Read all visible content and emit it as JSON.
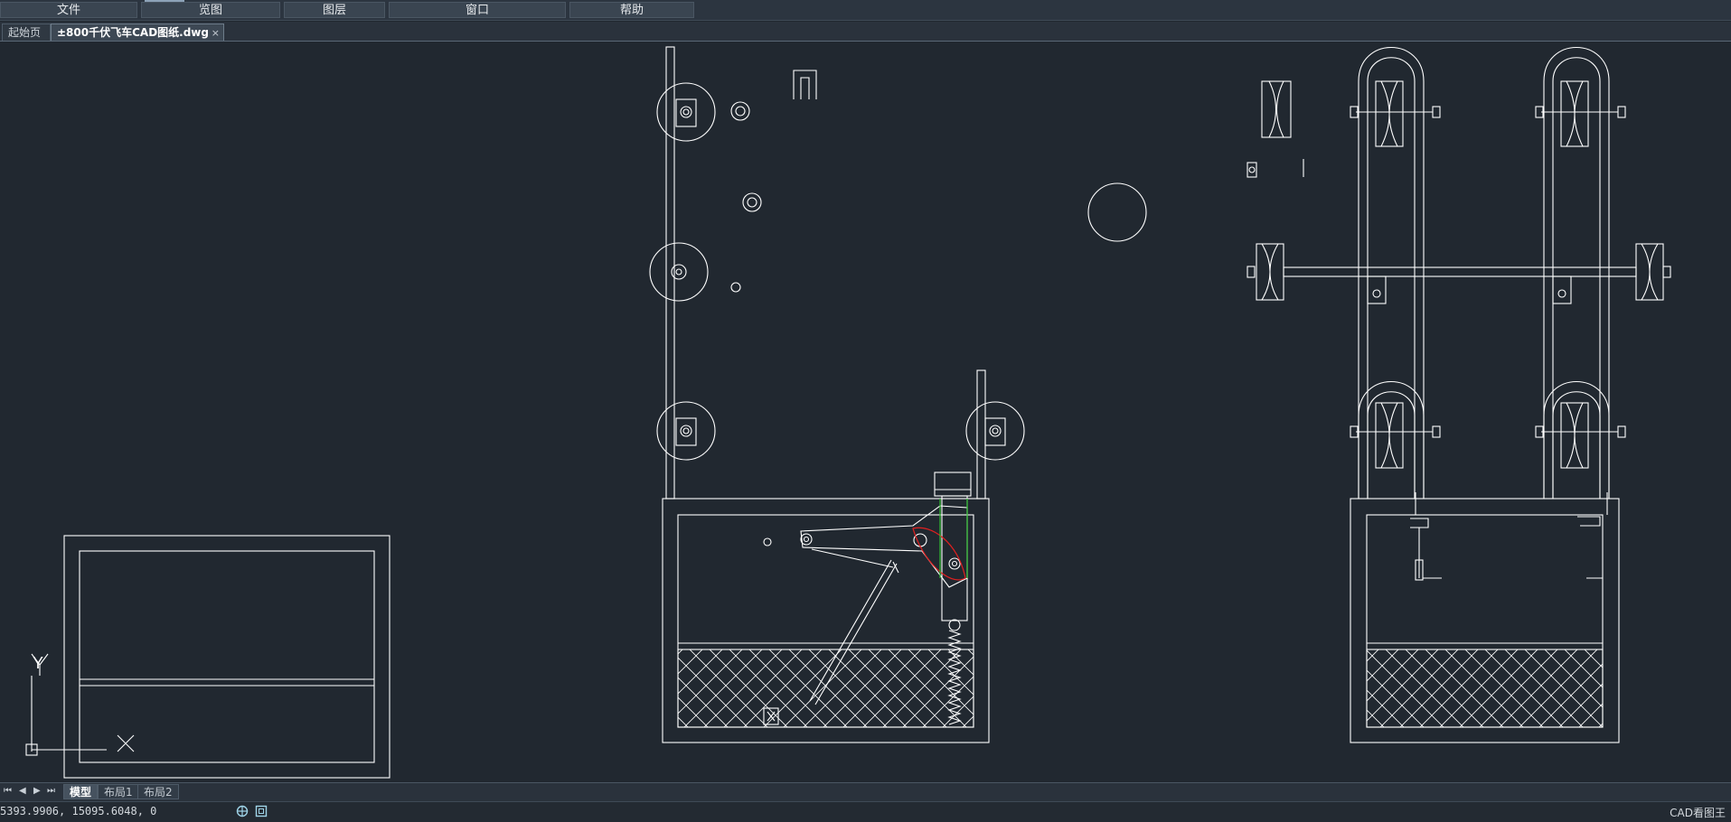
{
  "menubar": {
    "items": [
      {
        "label": "文件"
      },
      {
        "label": "览图"
      },
      {
        "label": "图层"
      },
      {
        "label": "窗口"
      },
      {
        "label": "帮助"
      }
    ]
  },
  "tabs": {
    "start": "起始页",
    "active": "±800千伏飞车CAD图纸.dwg",
    "close_glyph": "×"
  },
  "canvas": {
    "background": "#212830",
    "line_color": "#ffffff",
    "accent_colors": {
      "red": "#e02020",
      "green": "#30c030"
    },
    "ucs": {
      "x_label": "X",
      "y_label": "Y"
    }
  },
  "layout_tabs": {
    "nav": [
      "⏮",
      "◀",
      "▶",
      "⏭"
    ],
    "items": [
      "模型",
      "布局1",
      "布局2"
    ],
    "active_index": 0
  },
  "status": {
    "coords": "5393.9906, 15095.6048, 0",
    "icons": [
      "snap-icon",
      "grid-icon"
    ],
    "app_name": "CAD看图王"
  }
}
